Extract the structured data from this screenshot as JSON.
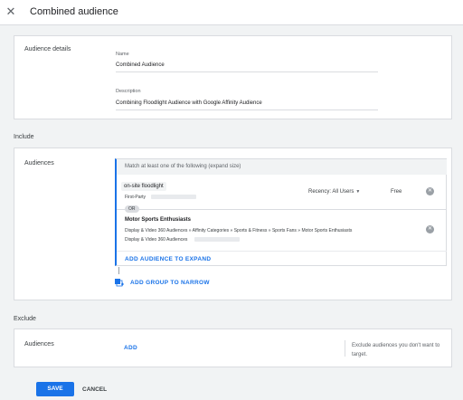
{
  "header": {
    "title": "Combined audience",
    "close_icon": "close-icon"
  },
  "audience_details": {
    "section_label": "Audience details",
    "name_label": "Name",
    "name_value": "Combined Audience",
    "description_label": "Description",
    "description_value": "Combining Floodlight Audience with Google Affinity Audience"
  },
  "include": {
    "heading": "Include",
    "section_label": "Audiences",
    "group_header": "Match at least one of the following (expand size)",
    "audiences": [
      {
        "name": "on-site floodlight",
        "source": "First-Party",
        "recency": "Recency: All Users",
        "price": "Free"
      },
      {
        "name": "Motor Sports Enthusiasts",
        "path": "Display & Video 360 Audiences » Affinity Categories » Sports & Fitness » Sports Fans » Motor Sports Enthusiasts",
        "source": "Display & Video 360 Audiences"
      }
    ],
    "or_label": "OR",
    "add_to_expand": "ADD AUDIENCE TO EXPAND",
    "add_group": "ADD GROUP TO NARROW"
  },
  "exclude": {
    "heading": "Exclude",
    "section_label": "Audiences",
    "add_label": "ADD",
    "helper": "Exclude audiences you don't want to target."
  },
  "footer": {
    "save_label": "SAVE",
    "cancel_label": "CANCEL"
  },
  "colors": {
    "accent": "#1a73e8",
    "background": "#f1f3f4",
    "card": "#ffffff"
  }
}
